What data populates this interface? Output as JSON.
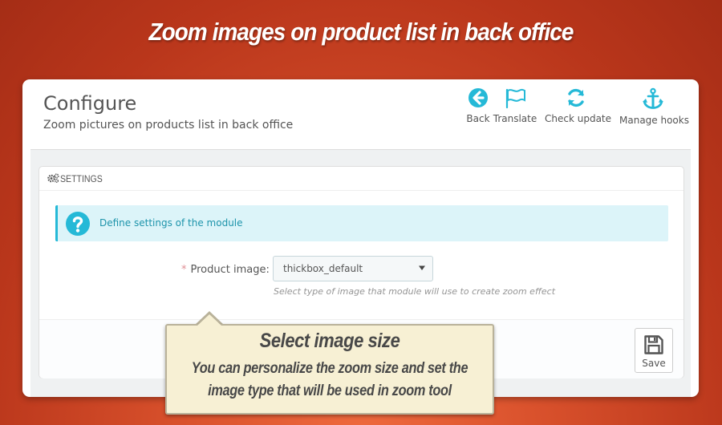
{
  "banner": {
    "headline": "Zoom images on product list in back office"
  },
  "page": {
    "title": "Configure",
    "subtitle": "Zoom pictures on products list in back office"
  },
  "toolbar": {
    "items": [
      {
        "label": "Back",
        "icon": "arrow-left-circle-icon"
      },
      {
        "label": "Translate",
        "icon": "flag-icon"
      },
      {
        "label": "Check update",
        "icon": "refresh-icon"
      },
      {
        "label": "Manage hooks",
        "icon": "anchor-icon"
      }
    ]
  },
  "settings": {
    "heading": "SETTINGS",
    "info": "Define settings of the module",
    "field_label": "Product image:",
    "required_mark": "*",
    "select_value": "thickbox_default",
    "help": "Select type of image that module will use to create zoom effect",
    "save_label": "Save"
  },
  "callout": {
    "title": "Select image size",
    "line1": "You can personalize the zoom size and set the",
    "line2": "image type that will be used in zoom tool"
  },
  "colors": {
    "accent": "#25b9d7",
    "info_bg": "#dcf4f9",
    "info_text": "#1e94ab",
    "background": "#c8421f",
    "callout_bg": "#f7f0d4"
  }
}
